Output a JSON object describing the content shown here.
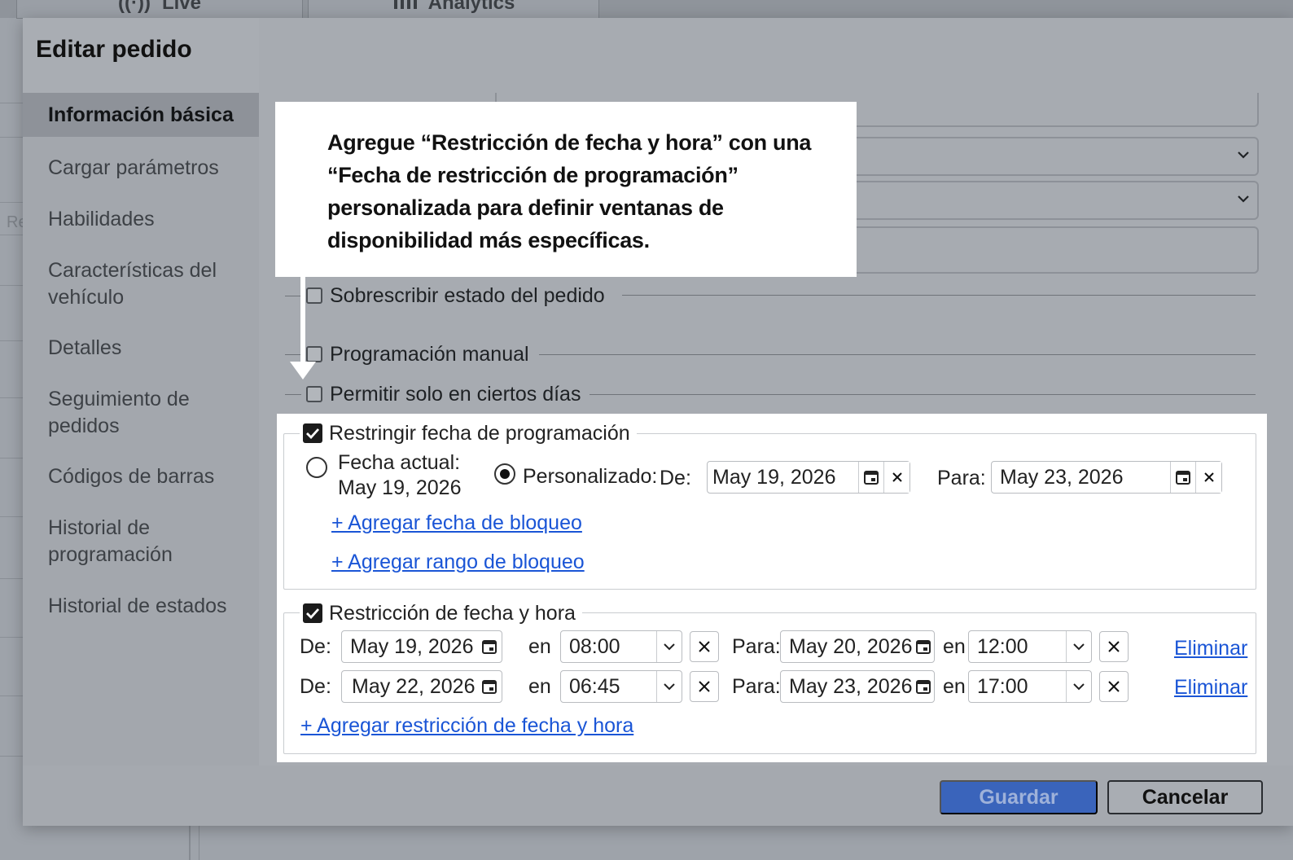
{
  "background": {
    "tabs": [
      {
        "label": "Live",
        "icon": "broadcast-icon"
      },
      {
        "label": "Analytics",
        "icon": "bar-chart-icon"
      }
    ],
    "left_fragment": "Re"
  },
  "modal": {
    "title": "Editar pedido",
    "sidebar": {
      "items": [
        {
          "label": "Información básica",
          "active": true
        },
        {
          "label": "Cargar parámetros"
        },
        {
          "label": "Habilidades"
        },
        {
          "label": "Características del vehículo"
        },
        {
          "label": "Detalles"
        },
        {
          "label": "Seguimiento de pedidos"
        },
        {
          "label": "Códigos de barras"
        },
        {
          "label": "Historial de programación"
        },
        {
          "label": "Historial de estados"
        }
      ]
    },
    "form": {
      "override_status": "Sobrescribir estado del pedido",
      "manual_scheduling": "Programación manual",
      "certain_days": "Permitir solo en ciertos días"
    },
    "restrict_schedule": {
      "legend": "Restringir fecha de programación",
      "checked": true,
      "current_date_label": "Fecha actual:",
      "current_date_value": "May 19, 2026",
      "custom_label": "Personalizado:",
      "from_label": "De:",
      "from_value": "May 19, 2026",
      "to_label": "Para:",
      "to_value": "May 23, 2026",
      "add_block_date": "+ Agregar fecha de bloqueo",
      "add_block_range": "+ Agregar rango de bloqueo"
    },
    "datetime_restriction": {
      "legend": "Restricción de fecha y hora",
      "checked": true,
      "at_label": "en",
      "from_label": "De:",
      "to_label": "Para:",
      "delete_label": "Eliminar",
      "rows": [
        {
          "from_date": "May 19, 2026",
          "from_time": "08:00",
          "to_date": "May 20, 2026",
          "to_time": "12:00"
        },
        {
          "from_date": "May 22, 2026",
          "from_time": "06:45",
          "to_date": "May 23, 2026",
          "to_time": "17:00"
        }
      ],
      "add_label": "+ Agregar restricción de fecha y hora"
    },
    "footer": {
      "save": "Guardar",
      "cancel": "Cancelar"
    }
  },
  "callout": {
    "text": "Agregue “Restricción de fecha y hora” con una “Fecha de restricción de programación” personalizada para definir ventanas de disponibilidad más específicas."
  }
}
